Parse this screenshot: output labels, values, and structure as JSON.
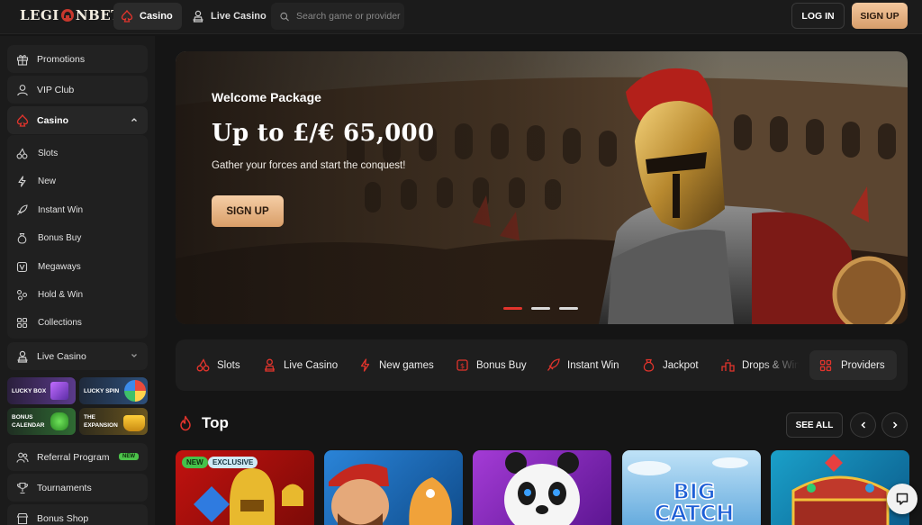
{
  "brand": {
    "logo_left": "LEGI",
    "logo_right": "NBET"
  },
  "header": {
    "tabs": [
      {
        "label": "Casino",
        "icon": "spade-icon",
        "active": true
      },
      {
        "label": "Live Casino",
        "icon": "dealer-icon",
        "active": false
      }
    ],
    "search_placeholder": "Search game or provider",
    "login_label": "LOG IN",
    "signup_label": "SIGN UP",
    "accent_color": "#e2342c",
    "button_gradient": [
      "#f3c79d",
      "#d79e6b"
    ]
  },
  "sidebar": {
    "top_items": [
      {
        "label": "Promotions",
        "icon": "gift-icon"
      },
      {
        "label": "VIP Club",
        "icon": "user-icon"
      }
    ],
    "casino": {
      "label": "Casino",
      "expanded": true,
      "sub_items": [
        {
          "label": "Slots",
          "icon": "cherries-icon"
        },
        {
          "label": "New",
          "icon": "lightning-icon"
        },
        {
          "label": "Instant Win",
          "icon": "rocket-icon"
        },
        {
          "label": "Bonus Buy",
          "icon": "money-bag-icon"
        },
        {
          "label": "Megaways",
          "icon": "diamond-icon"
        },
        {
          "label": "Hold & Win",
          "icon": "coins-icon"
        },
        {
          "label": "Collections",
          "icon": "grid-icon"
        }
      ]
    },
    "live_casino": {
      "label": "Live Casino",
      "icon": "dealer-icon"
    },
    "promo_tiles": [
      {
        "label": "LUCKY BOX"
      },
      {
        "label": "LUCKY SPIN"
      },
      {
        "label": "BONUS CALENDAR"
      },
      {
        "label": "THE EXPANSION"
      }
    ],
    "bottom_items": [
      {
        "label": "Referral Program",
        "icon": "users-icon",
        "badge": "NEW"
      },
      {
        "label": "Tournaments",
        "icon": "trophy-icon"
      },
      {
        "label": "Bonus Shop",
        "icon": "shop-icon"
      }
    ]
  },
  "hero": {
    "subtitle": "Welcome Package",
    "title": "Up to £/€ 65,000",
    "description": "Gather your forces and start the conquest!",
    "button_label": "SIGN UP",
    "slide_count": 3,
    "active_slide": 1
  },
  "categories": [
    {
      "label": "Slots",
      "icon": "cherries-icon"
    },
    {
      "label": "Live Casino",
      "icon": "dealer-icon"
    },
    {
      "label": "New games",
      "icon": "lightning-icon"
    },
    {
      "label": "Bonus Buy",
      "icon": "money-bag-icon"
    },
    {
      "label": "Instant Win",
      "icon": "rocket-icon"
    },
    {
      "label": "Jackpot",
      "icon": "coin-bag-icon"
    },
    {
      "label": "Drops & Wins",
      "icon": "podium-icon"
    },
    {
      "label": "Providers",
      "icon": "grid-icon"
    }
  ],
  "top_section": {
    "title": "Top",
    "see_all_label": "SEE ALL",
    "games": [
      {
        "tags": [
          "NEW",
          "EXCLUSIVE"
        ]
      },
      {
        "tags": []
      },
      {
        "tags": []
      },
      {
        "tags": [],
        "art_text": "BIG CATCH"
      },
      {
        "tags": []
      }
    ]
  }
}
